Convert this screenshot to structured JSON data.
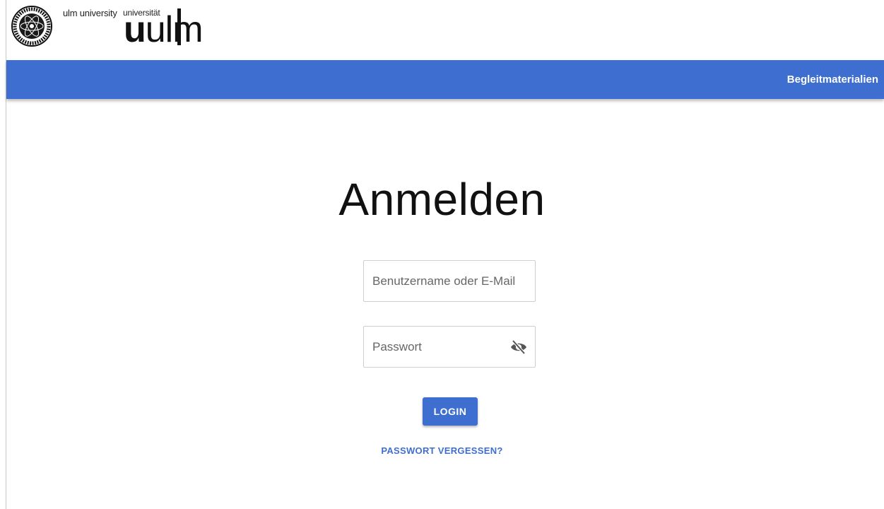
{
  "header": {
    "university_en": "ulm university",
    "university_de": "universität",
    "logo_bold": "u",
    "logo_rest": "ulm"
  },
  "navbar": {
    "link_label": "Begleitmaterialien",
    "color": "#3e6fd0"
  },
  "login": {
    "title": "Anmelden",
    "username_placeholder": "Benutzername oder E-Mail",
    "password_placeholder": "Passwort",
    "password_toggle_icon": "eye-off-icon",
    "login_label": "LOGIN",
    "forgot_label": "PASSWORT VERGESSEN?"
  }
}
